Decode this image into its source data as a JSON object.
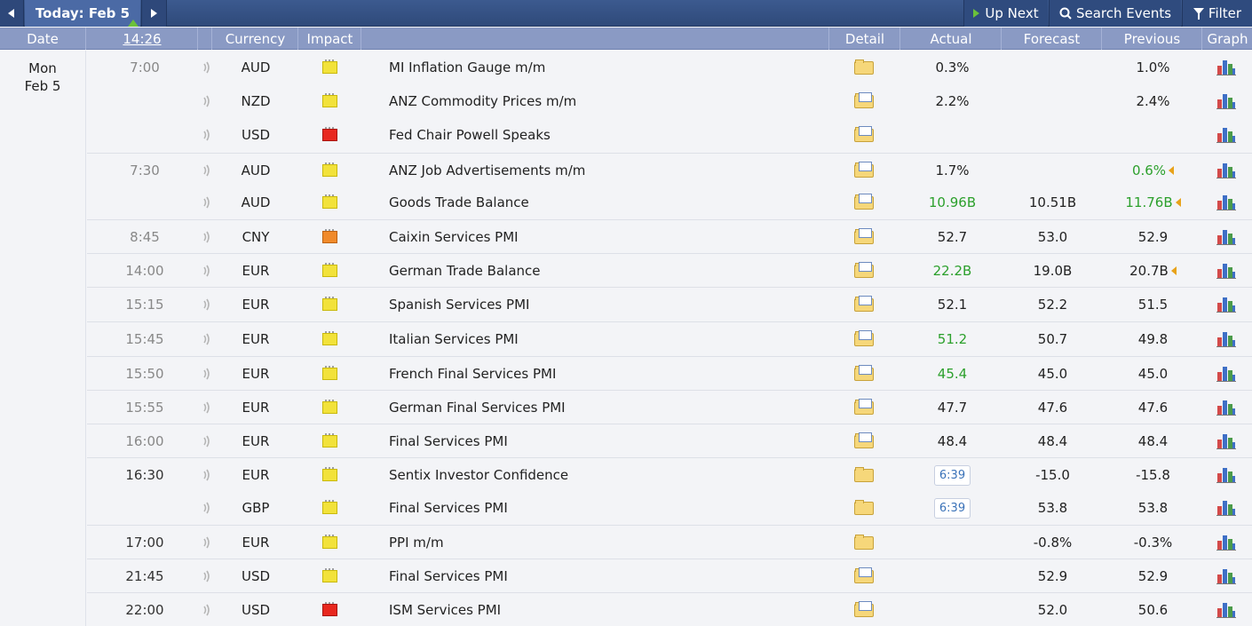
{
  "nav": {
    "prev_icon": "triangle-left",
    "today_label": "Today: Feb 5",
    "next_icon": "triangle-right",
    "up_next_label": "Up Next",
    "search_label": "Search Events",
    "filter_label": "Filter"
  },
  "columns": {
    "date": "Date",
    "time": "14:26",
    "currency": "Currency",
    "impact": "Impact",
    "detail": "Detail",
    "actual": "Actual",
    "forecast": "Forecast",
    "previous": "Previous",
    "graph": "Graph"
  },
  "day": {
    "weekday": "Mon",
    "date": "Feb 5"
  },
  "colors": {
    "yellow": "#f2e23a",
    "red": "#e8271e",
    "orange": "#f08a2a",
    "green": "#2ca02c",
    "header": "#8a9ac4"
  },
  "events": [
    {
      "time": "7:00",
      "currency": "AUD",
      "impact": "yellow",
      "event": "MI Inflation Gauge m/m",
      "actual": "0.3%",
      "forecast": "",
      "previous": "1.0%"
    },
    {
      "time": "",
      "currency": "NZD",
      "impact": "yellow",
      "event": "ANZ Commodity Prices m/m",
      "actual": "2.2%",
      "forecast": "",
      "previous": "2.4%"
    },
    {
      "time": "",
      "currency": "USD",
      "impact": "red",
      "event": "Fed Chair Powell Speaks",
      "actual": "",
      "forecast": "",
      "previous": ""
    },
    {
      "time": "7:30",
      "currency": "AUD",
      "impact": "yellow",
      "event": "ANZ Job Advertisements m/m",
      "actual": "1.7%",
      "forecast": "",
      "previous": "0.6%"
    },
    {
      "time": "",
      "currency": "AUD",
      "impact": "yellow",
      "event": "Goods Trade Balance",
      "actual": "10.96B",
      "forecast": "10.51B",
      "previous": "11.76B"
    },
    {
      "time": "8:45",
      "currency": "CNY",
      "impact": "orange",
      "event": "Caixin Services PMI",
      "actual": "52.7",
      "forecast": "53.0",
      "previous": "52.9"
    },
    {
      "time": "14:00",
      "currency": "EUR",
      "impact": "yellow",
      "event": "German Trade Balance",
      "actual": "22.2B",
      "forecast": "19.0B",
      "previous": "20.7B"
    },
    {
      "time": "15:15",
      "currency": "EUR",
      "impact": "yellow",
      "event": "Spanish Services PMI",
      "actual": "52.1",
      "forecast": "52.2",
      "previous": "51.5"
    },
    {
      "time": "15:45",
      "currency": "EUR",
      "impact": "yellow",
      "event": "Italian Services PMI",
      "actual": "51.2",
      "forecast": "50.7",
      "previous": "49.8"
    },
    {
      "time": "15:50",
      "currency": "EUR",
      "impact": "yellow",
      "event": "French Final Services PMI",
      "actual": "45.4",
      "forecast": "45.0",
      "previous": "45.0"
    },
    {
      "time": "15:55",
      "currency": "EUR",
      "impact": "yellow",
      "event": "German Final Services PMI",
      "actual": "47.7",
      "forecast": "47.6",
      "previous": "47.6"
    },
    {
      "time": "16:00",
      "currency": "EUR",
      "impact": "yellow",
      "event": "Final Services PMI",
      "actual": "48.4",
      "forecast": "48.4",
      "previous": "48.4"
    },
    {
      "time": "16:30",
      "currency": "EUR",
      "impact": "yellow",
      "event": "Sentix Investor Confidence",
      "actual": "6:39",
      "forecast": "-15.0",
      "previous": "-15.8"
    },
    {
      "time": "",
      "currency": "GBP",
      "impact": "yellow",
      "event": "Final Services PMI",
      "actual": "6:39",
      "forecast": "53.8",
      "previous": "53.8"
    },
    {
      "time": "17:00",
      "currency": "EUR",
      "impact": "yellow",
      "event": "PPI m/m",
      "actual": "",
      "forecast": "-0.8%",
      "previous": "-0.3%"
    },
    {
      "time": "21:45",
      "currency": "USD",
      "impact": "yellow",
      "event": "Final Services PMI",
      "actual": "",
      "forecast": "52.9",
      "previous": "52.9"
    },
    {
      "time": "22:00",
      "currency": "USD",
      "impact": "red",
      "event": "ISM Services PMI",
      "actual": "",
      "forecast": "52.0",
      "previous": "50.6"
    }
  ]
}
